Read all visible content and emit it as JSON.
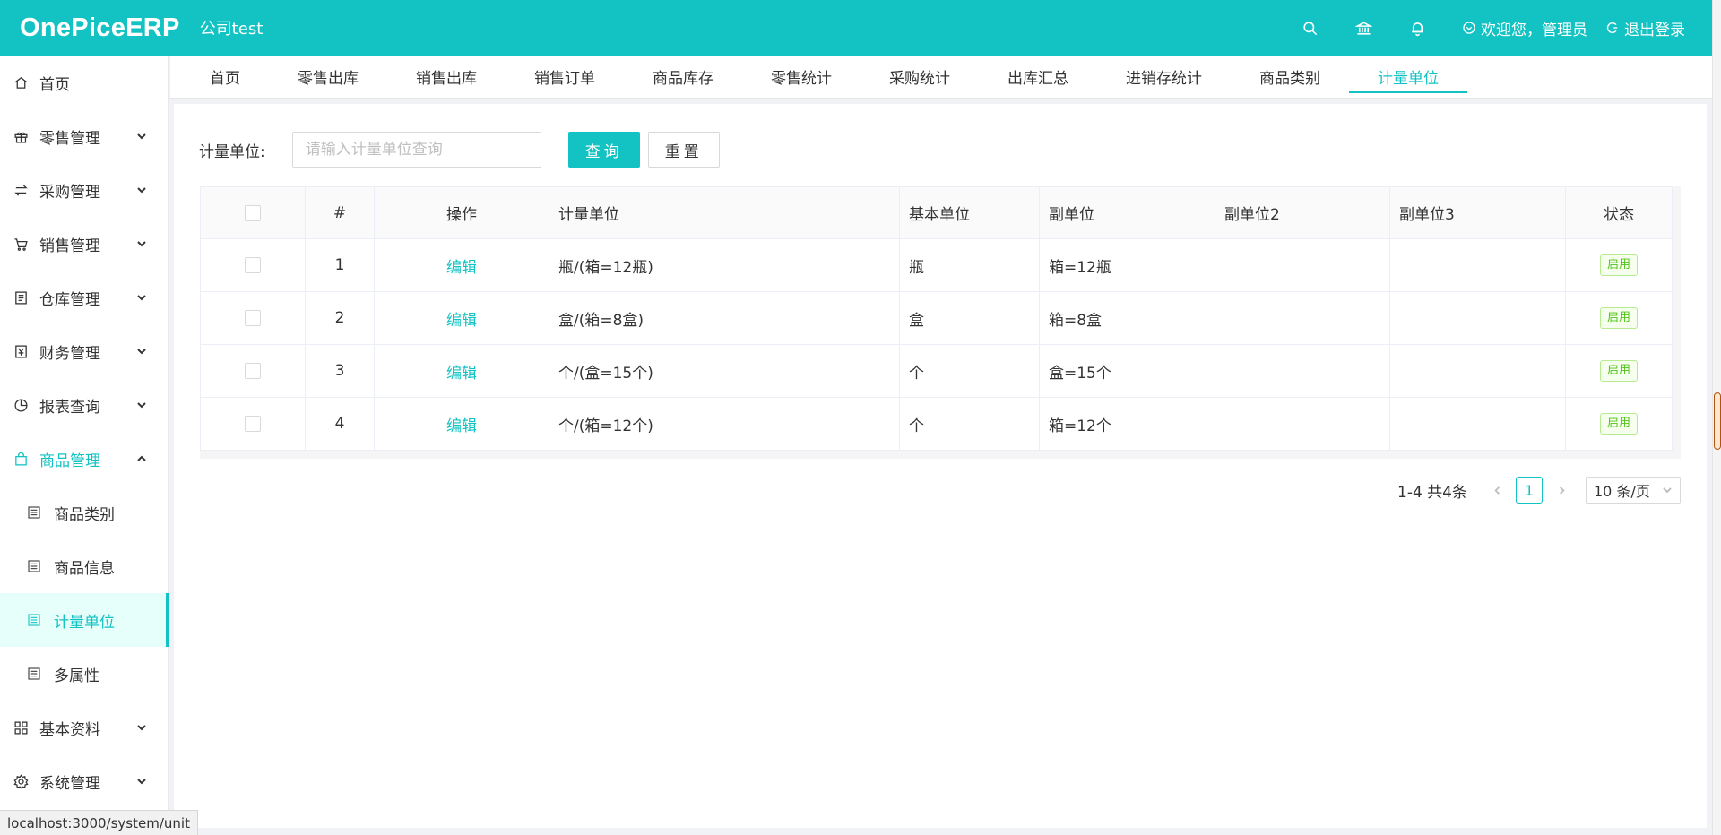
{
  "header": {
    "logo": "OnePiceERP",
    "company": "公司test",
    "welcome": "欢迎您，管理员",
    "logout": "退出登录"
  },
  "sidebar": {
    "items": [
      {
        "label": "首页",
        "icon": "home-icon"
      },
      {
        "label": "零售管理",
        "icon": "gift-icon"
      },
      {
        "label": "采购管理",
        "icon": "swap-icon"
      },
      {
        "label": "销售管理",
        "icon": "cart-icon"
      },
      {
        "label": "仓库管理",
        "icon": "warehouse-icon"
      },
      {
        "label": "财务管理",
        "icon": "finance-icon"
      },
      {
        "label": "报表查询",
        "icon": "pie-chart-icon"
      },
      {
        "label": "商品管理",
        "icon": "shopping-bag-icon"
      },
      {
        "label": "基本资料",
        "icon": "grid-icon"
      },
      {
        "label": "系统管理",
        "icon": "settings-icon"
      }
    ],
    "sub_items": [
      {
        "label": "商品类别"
      },
      {
        "label": "商品信息"
      },
      {
        "label": "计量单位"
      },
      {
        "label": "多属性"
      }
    ]
  },
  "tabs": [
    "首页",
    "零售出库",
    "销售出库",
    "销售订单",
    "商品库存",
    "零售统计",
    "采购统计",
    "出库汇总",
    "进销存统计",
    "商品类别",
    "计量单位"
  ],
  "search": {
    "label": "计量单位:",
    "placeholder": "请输入计量单位查询",
    "query_label": "查询",
    "reset_label": "重置"
  },
  "table": {
    "headers": [
      "#",
      "操作",
      "计量单位",
      "基本单位",
      "副单位",
      "副单位2",
      "副单位3",
      "状态"
    ],
    "rows": [
      {
        "no": "1",
        "action": "编辑",
        "unit": "瓶/(箱=12瓶)",
        "base": "瓶",
        "sub1": "箱=12瓶",
        "sub2": "",
        "sub3": "",
        "status": "启用"
      },
      {
        "no": "2",
        "action": "编辑",
        "unit": "盒/(箱=8盒)",
        "base": "盒",
        "sub1": "箱=8盒",
        "sub2": "",
        "sub3": "",
        "status": "启用"
      },
      {
        "no": "3",
        "action": "编辑",
        "unit": "个/(盒=15个)",
        "base": "个",
        "sub1": "盒=15个",
        "sub2": "",
        "sub3": "",
        "status": "启用"
      },
      {
        "no": "4",
        "action": "编辑",
        "unit": "个/(箱=12个)",
        "base": "个",
        "sub1": "箱=12个",
        "sub2": "",
        "sub3": "",
        "status": "启用"
      }
    ]
  },
  "pagination": {
    "total": "1-4 共4条",
    "current": "1",
    "page_size": "10 条/页"
  },
  "status_url": "localhost:3000/system/unit",
  "colors": {
    "accent": "#13c2c2",
    "success": "#52c41a"
  }
}
